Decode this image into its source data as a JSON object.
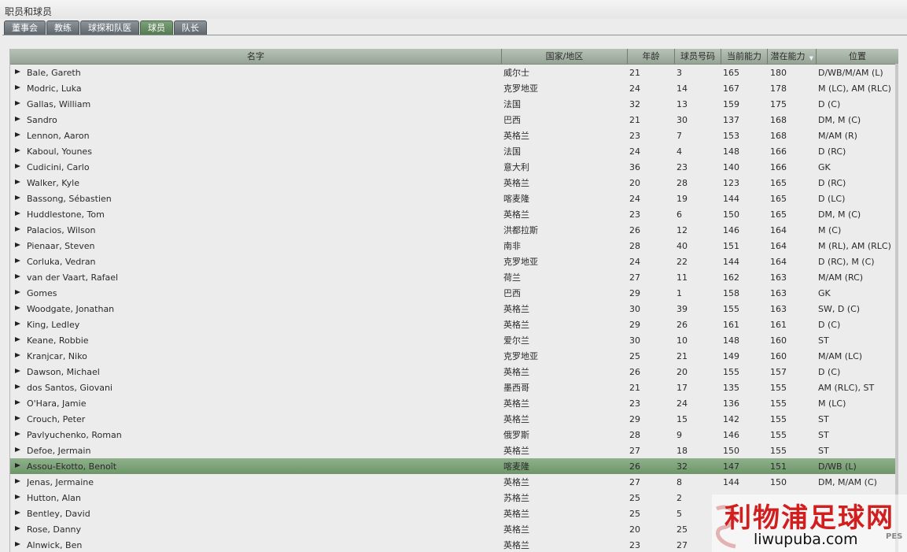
{
  "window": {
    "title": "职员和球员"
  },
  "tabs": [
    {
      "label": "董事会",
      "active": false
    },
    {
      "label": "教练",
      "active": false
    },
    {
      "label": "球探和队医",
      "active": false
    },
    {
      "label": "球员",
      "active": true
    },
    {
      "label": "队长",
      "active": false
    }
  ],
  "table": {
    "columns": [
      "名字",
      "国家/地区",
      "年龄",
      "球员号码",
      "当前能力",
      "潜在能力",
      "位置"
    ],
    "sorted_by": "潜在能力",
    "rows": [
      [
        "Bale, Gareth",
        "威尔士",
        "21",
        "3",
        "165",
        "180",
        "D/WB/M/AM (L)"
      ],
      [
        "Modric, Luka",
        "克罗地亚",
        "24",
        "14",
        "167",
        "178",
        "M (LC), AM (RLC)"
      ],
      [
        "Gallas, William",
        "法国",
        "32",
        "13",
        "159",
        "175",
        "D (C)"
      ],
      [
        "Sandro",
        "巴西",
        "21",
        "30",
        "137",
        "168",
        "DM, M (C)"
      ],
      [
        "Lennon, Aaron",
        "英格兰",
        "23",
        "7",
        "153",
        "168",
        "M/AM (R)"
      ],
      [
        "Kaboul, Younes",
        "法国",
        "24",
        "4",
        "148",
        "166",
        "D (RC)"
      ],
      [
        "Cudicini, Carlo",
        "意大利",
        "36",
        "23",
        "140",
        "166",
        "GK"
      ],
      [
        "Walker, Kyle",
        "英格兰",
        "20",
        "28",
        "123",
        "165",
        "D (RC)"
      ],
      [
        "Bassong, Sébastien",
        "喀麦隆",
        "24",
        "19",
        "144",
        "165",
        "D (LC)"
      ],
      [
        "Huddlestone, Tom",
        "英格兰",
        "23",
        "6",
        "150",
        "165",
        "DM, M (C)"
      ],
      [
        "Palacios, Wilson",
        "洪都拉斯",
        "26",
        "12",
        "146",
        "164",
        "M (C)"
      ],
      [
        "Pienaar, Steven",
        "南非",
        "28",
        "40",
        "151",
        "164",
        "M (RL), AM (RLC)"
      ],
      [
        "Corluka, Vedran",
        "克罗地亚",
        "24",
        "22",
        "144",
        "164",
        "D (RC), M (C)"
      ],
      [
        "van der Vaart, Rafael",
        "荷兰",
        "27",
        "11",
        "162",
        "163",
        "M/AM (RC)"
      ],
      [
        "Gomes",
        "巴西",
        "29",
        "1",
        "158",
        "163",
        "GK"
      ],
      [
        "Woodgate, Jonathan",
        "英格兰",
        "30",
        "39",
        "155",
        "163",
        "SW, D (C)"
      ],
      [
        "King, Ledley",
        "英格兰",
        "29",
        "26",
        "161",
        "161",
        "D (C)"
      ],
      [
        "Keane, Robbie",
        "爱尔兰",
        "30",
        "10",
        "148",
        "160",
        "ST"
      ],
      [
        "Kranjcar, Niko",
        "克罗地亚",
        "25",
        "21",
        "149",
        "160",
        "M/AM (LC)"
      ],
      [
        "Dawson, Michael",
        "英格兰",
        "26",
        "20",
        "155",
        "157",
        "D (C)"
      ],
      [
        "dos Santos, Giovani",
        "墨西哥",
        "21",
        "17",
        "135",
        "155",
        "AM (RLC), ST"
      ],
      [
        "O'Hara, Jamie",
        "英格兰",
        "23",
        "24",
        "136",
        "155",
        "M (LC)"
      ],
      [
        "Crouch, Peter",
        "英格兰",
        "29",
        "15",
        "142",
        "155",
        "ST"
      ],
      [
        "Pavlyuchenko, Roman",
        "俄罗斯",
        "28",
        "9",
        "146",
        "155",
        "ST"
      ],
      [
        "Defoe, Jermain",
        "英格兰",
        "27",
        "18",
        "150",
        "155",
        "ST"
      ],
      [
        "Assou-Ekotto, Benoît",
        "喀麦隆",
        "26",
        "32",
        "147",
        "151",
        "D/WB (L)"
      ],
      [
        "Jenas, Jermaine",
        "英格兰",
        "27",
        "8",
        "144",
        "150",
        "DM, M/AM (C)"
      ],
      [
        "Hutton, Alan",
        "苏格兰",
        "25",
        "2",
        "",
        "",
        ""
      ],
      [
        "Bentley, David",
        "英格兰",
        "25",
        "5",
        "",
        "",
        ""
      ],
      [
        "Rose, Danny",
        "英格兰",
        "20",
        "25",
        "",
        "",
        ""
      ],
      [
        "Alnwick, Ben",
        "英格兰",
        "23",
        "27",
        "",
        "",
        ""
      ]
    ],
    "selected_row": 25
  },
  "watermark": {
    "title": "利物浦足球网",
    "url": "liwupuba.com",
    "logo": "PES"
  },
  "colors": {
    "selected_row": "#7ea27a",
    "active_tab": "#6e926a",
    "header": "#a9b7a9"
  }
}
